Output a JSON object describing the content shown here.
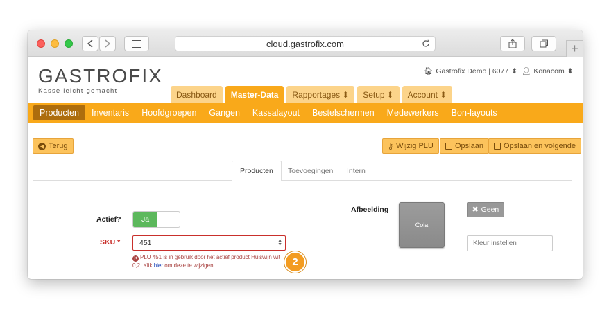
{
  "browser": {
    "url": "cloud.gastrofix.com",
    "tab_plus": "+"
  },
  "header": {
    "logo": "GASTROFIX",
    "tagline": "Kasse leicht gemacht",
    "account": "Gastrofix Demo | 6077",
    "user": "Konacom"
  },
  "main_tabs": [
    {
      "label": "Dashboard",
      "caret": ""
    },
    {
      "label": "Master-Data",
      "caret": ""
    },
    {
      "label": "Rapportages",
      "caret": "⬍"
    },
    {
      "label": "Setup",
      "caret": "⬍"
    },
    {
      "label": "Account",
      "caret": "⬍"
    }
  ],
  "sub_nav": [
    "Producten",
    "Inventaris",
    "Hoofdgroepen",
    "Gangen",
    "Kassalayout",
    "Bestelschermen",
    "Medewerkers",
    "Bon-layouts"
  ],
  "actions": {
    "back": "Terug",
    "change_plu": "Wijzig PLU",
    "save": "Opslaan",
    "save_next": "Opslaan en volgende"
  },
  "content_tabs": [
    "Producten",
    "Toevoegingen",
    "Intern"
  ],
  "form": {
    "active_label": "Actief?",
    "active_value": "Ja",
    "sku_label": "SKU *",
    "sku_value": "451",
    "error_text_1": "PLU 451 is in gebruik door het actief product Huiswijn wit 0,2. Klik ",
    "error_link": "hier",
    "error_text_2": " om deze te wijzigen.",
    "image_label": "Afbeelding",
    "image_text": "Cola",
    "none_button": "Geen",
    "color_placeholder": "Kleur instellen"
  },
  "badge": "2",
  "colors": {
    "accent": "#f9a91a",
    "active_subnav": "#ad6d0d",
    "error": "#a94442",
    "success": "#5cb85c"
  }
}
